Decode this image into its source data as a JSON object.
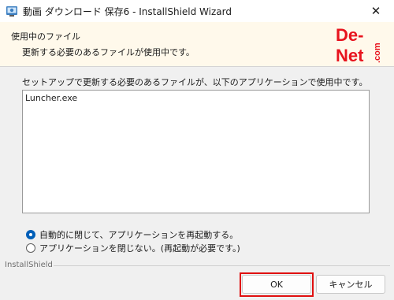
{
  "window": {
    "title": "動画 ダウンロード 保存6 - InstallShield Wizard",
    "close_glyph": "✕"
  },
  "banner": {
    "title": "使用中のファイル",
    "description": "更新する必要のあるファイルが使用中です。",
    "logo_text": "De-Net",
    "logo_suffix": ".com",
    "logo_color": "#e8141e"
  },
  "main": {
    "instruction": "セットアップで更新する必要のあるファイルが、以下のアプリケーションで使用中です。",
    "files": [
      "Luncher.exe"
    ],
    "options": [
      {
        "label": "自動的に閉じて、アプリケーションを再起動する。",
        "checked": true
      },
      {
        "label": "アプリケーションを閉じない。(再起動が必要です。)",
        "checked": false
      }
    ]
  },
  "footer": {
    "brand": "InstallShield",
    "ok_label": "OK",
    "cancel_label": "キャンセル"
  },
  "colors": {
    "accent": "#005fb8",
    "highlight": "#e01010",
    "banner_bg": "#fff9eb"
  }
}
